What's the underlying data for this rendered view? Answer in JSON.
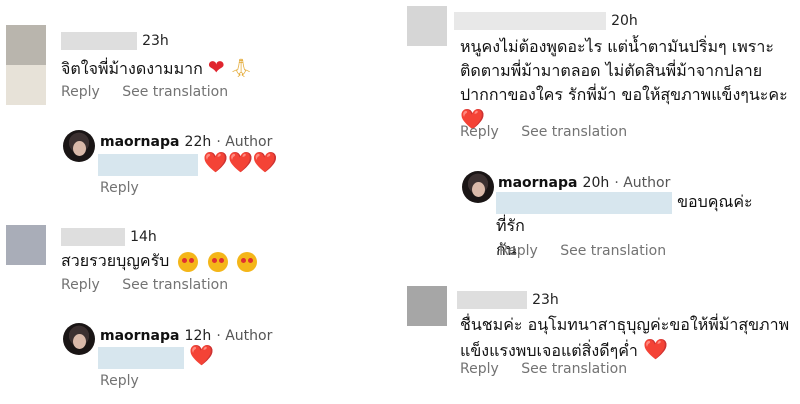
{
  "left": {
    "comment1": {
      "time": "23h",
      "text": "จิตใจพี่ม้างดงามมาก",
      "heart": "❤️",
      "pray": "🙏",
      "reply": "Reply",
      "translate": "See translation"
    },
    "reply1": {
      "username": "maornapa",
      "time": "22h",
      "author": "· Author",
      "hearts": "❤️❤️❤️",
      "reply": "Reply"
    },
    "comment2": {
      "time": "14h",
      "text": "สวยรวยบุญครับ",
      "reply": "Reply",
      "translate": "See translation"
    },
    "reply2": {
      "username": "maornapa",
      "time": "12h",
      "author": "· Author",
      "hearts": "❤️",
      "reply": "Reply"
    }
  },
  "right": {
    "comment1": {
      "time": "20h",
      "line1": "หนูคงไม่ต้องพูดอะไร แต่น้ำตามันปริ่มๆ เพราะ",
      "line2": "ติดตามพี่ม้ามาตลอด ไม่ตัดสินพี่ม้าจากปลาย",
      "line3": "ปากกาของใคร รักพี่ม้า ขอให้สุขภาพแข็งๆนะคะ",
      "heart": "❤️",
      "reply": "Reply",
      "translate": "See translation"
    },
    "reply1": {
      "username": "maornapa",
      "time": "20h",
      "author": "· Author",
      "line1": "ขอบคุณค่ะ ที่รัก",
      "line2": "กัน",
      "reply": "Reply",
      "translate": "See translation"
    },
    "comment2": {
      "time": "23h",
      "line1": "ชื่นชมค่ะ อนุโมทนาสาธุบุญค่ะขอให้พี่ม้าสุขภาพ",
      "line2": "แข็งแรงพบเจอแต่สิ่งดีๆค่ำ",
      "heart": "❤️",
      "reply": "Reply",
      "translate": "See translation"
    }
  }
}
